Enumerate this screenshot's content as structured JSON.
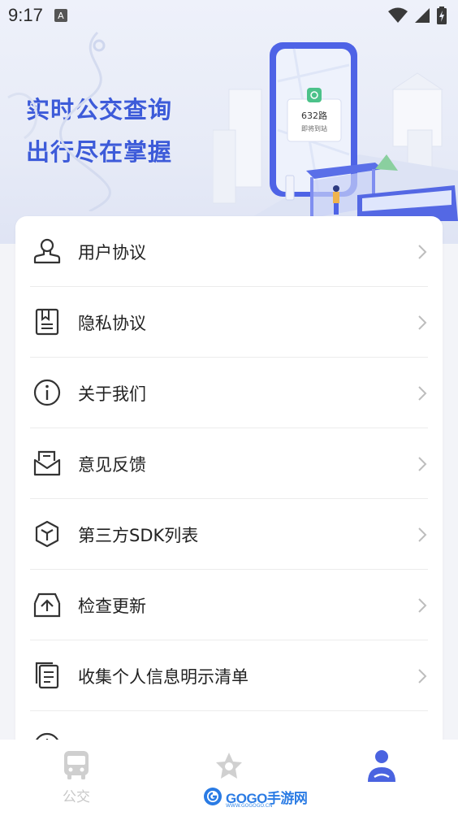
{
  "status_bar": {
    "time": "9:17",
    "notification_icon": "a-box-icon",
    "icons": [
      "wifi-icon",
      "cell-signal-icon",
      "battery-charging-icon"
    ]
  },
  "banner": {
    "title_line1": "实时公交查询",
    "title_line2": "出行尽在掌握",
    "illustration": {
      "phone_route": "632路",
      "phone_status": "即将到站"
    },
    "accent_color": "#3d5bd9"
  },
  "menu": {
    "items": [
      {
        "label": "用户协议",
        "icon": "user-stamp-icon"
      },
      {
        "label": "隐私协议",
        "icon": "privacy-document-icon"
      },
      {
        "label": "关于我们",
        "icon": "info-circle-icon"
      },
      {
        "label": "意见反馈",
        "icon": "feedback-mail-icon"
      },
      {
        "label": "第三方SDK列表",
        "icon": "cube-icon"
      },
      {
        "label": "检查更新",
        "icon": "update-tray-icon"
      },
      {
        "label": "收集个人信息明示清单",
        "icon": "document-list-icon"
      },
      {
        "label": "",
        "icon": "clock-icon"
      }
    ],
    "chevron_icon": "chevron-right-icon"
  },
  "bottom_nav": {
    "items": [
      {
        "label": "公交",
        "icon": "bus-icon",
        "active": false
      },
      {
        "label": "",
        "icon": "star-icon",
        "active": false
      },
      {
        "label": "",
        "icon": "profile-icon",
        "active": true
      }
    ],
    "inactive_color": "#c8c8c8",
    "active_color": "#4a63e0"
  },
  "watermark": {
    "brand": "GOGO手游网",
    "sub": "WWW.GOGOGO.CN"
  }
}
